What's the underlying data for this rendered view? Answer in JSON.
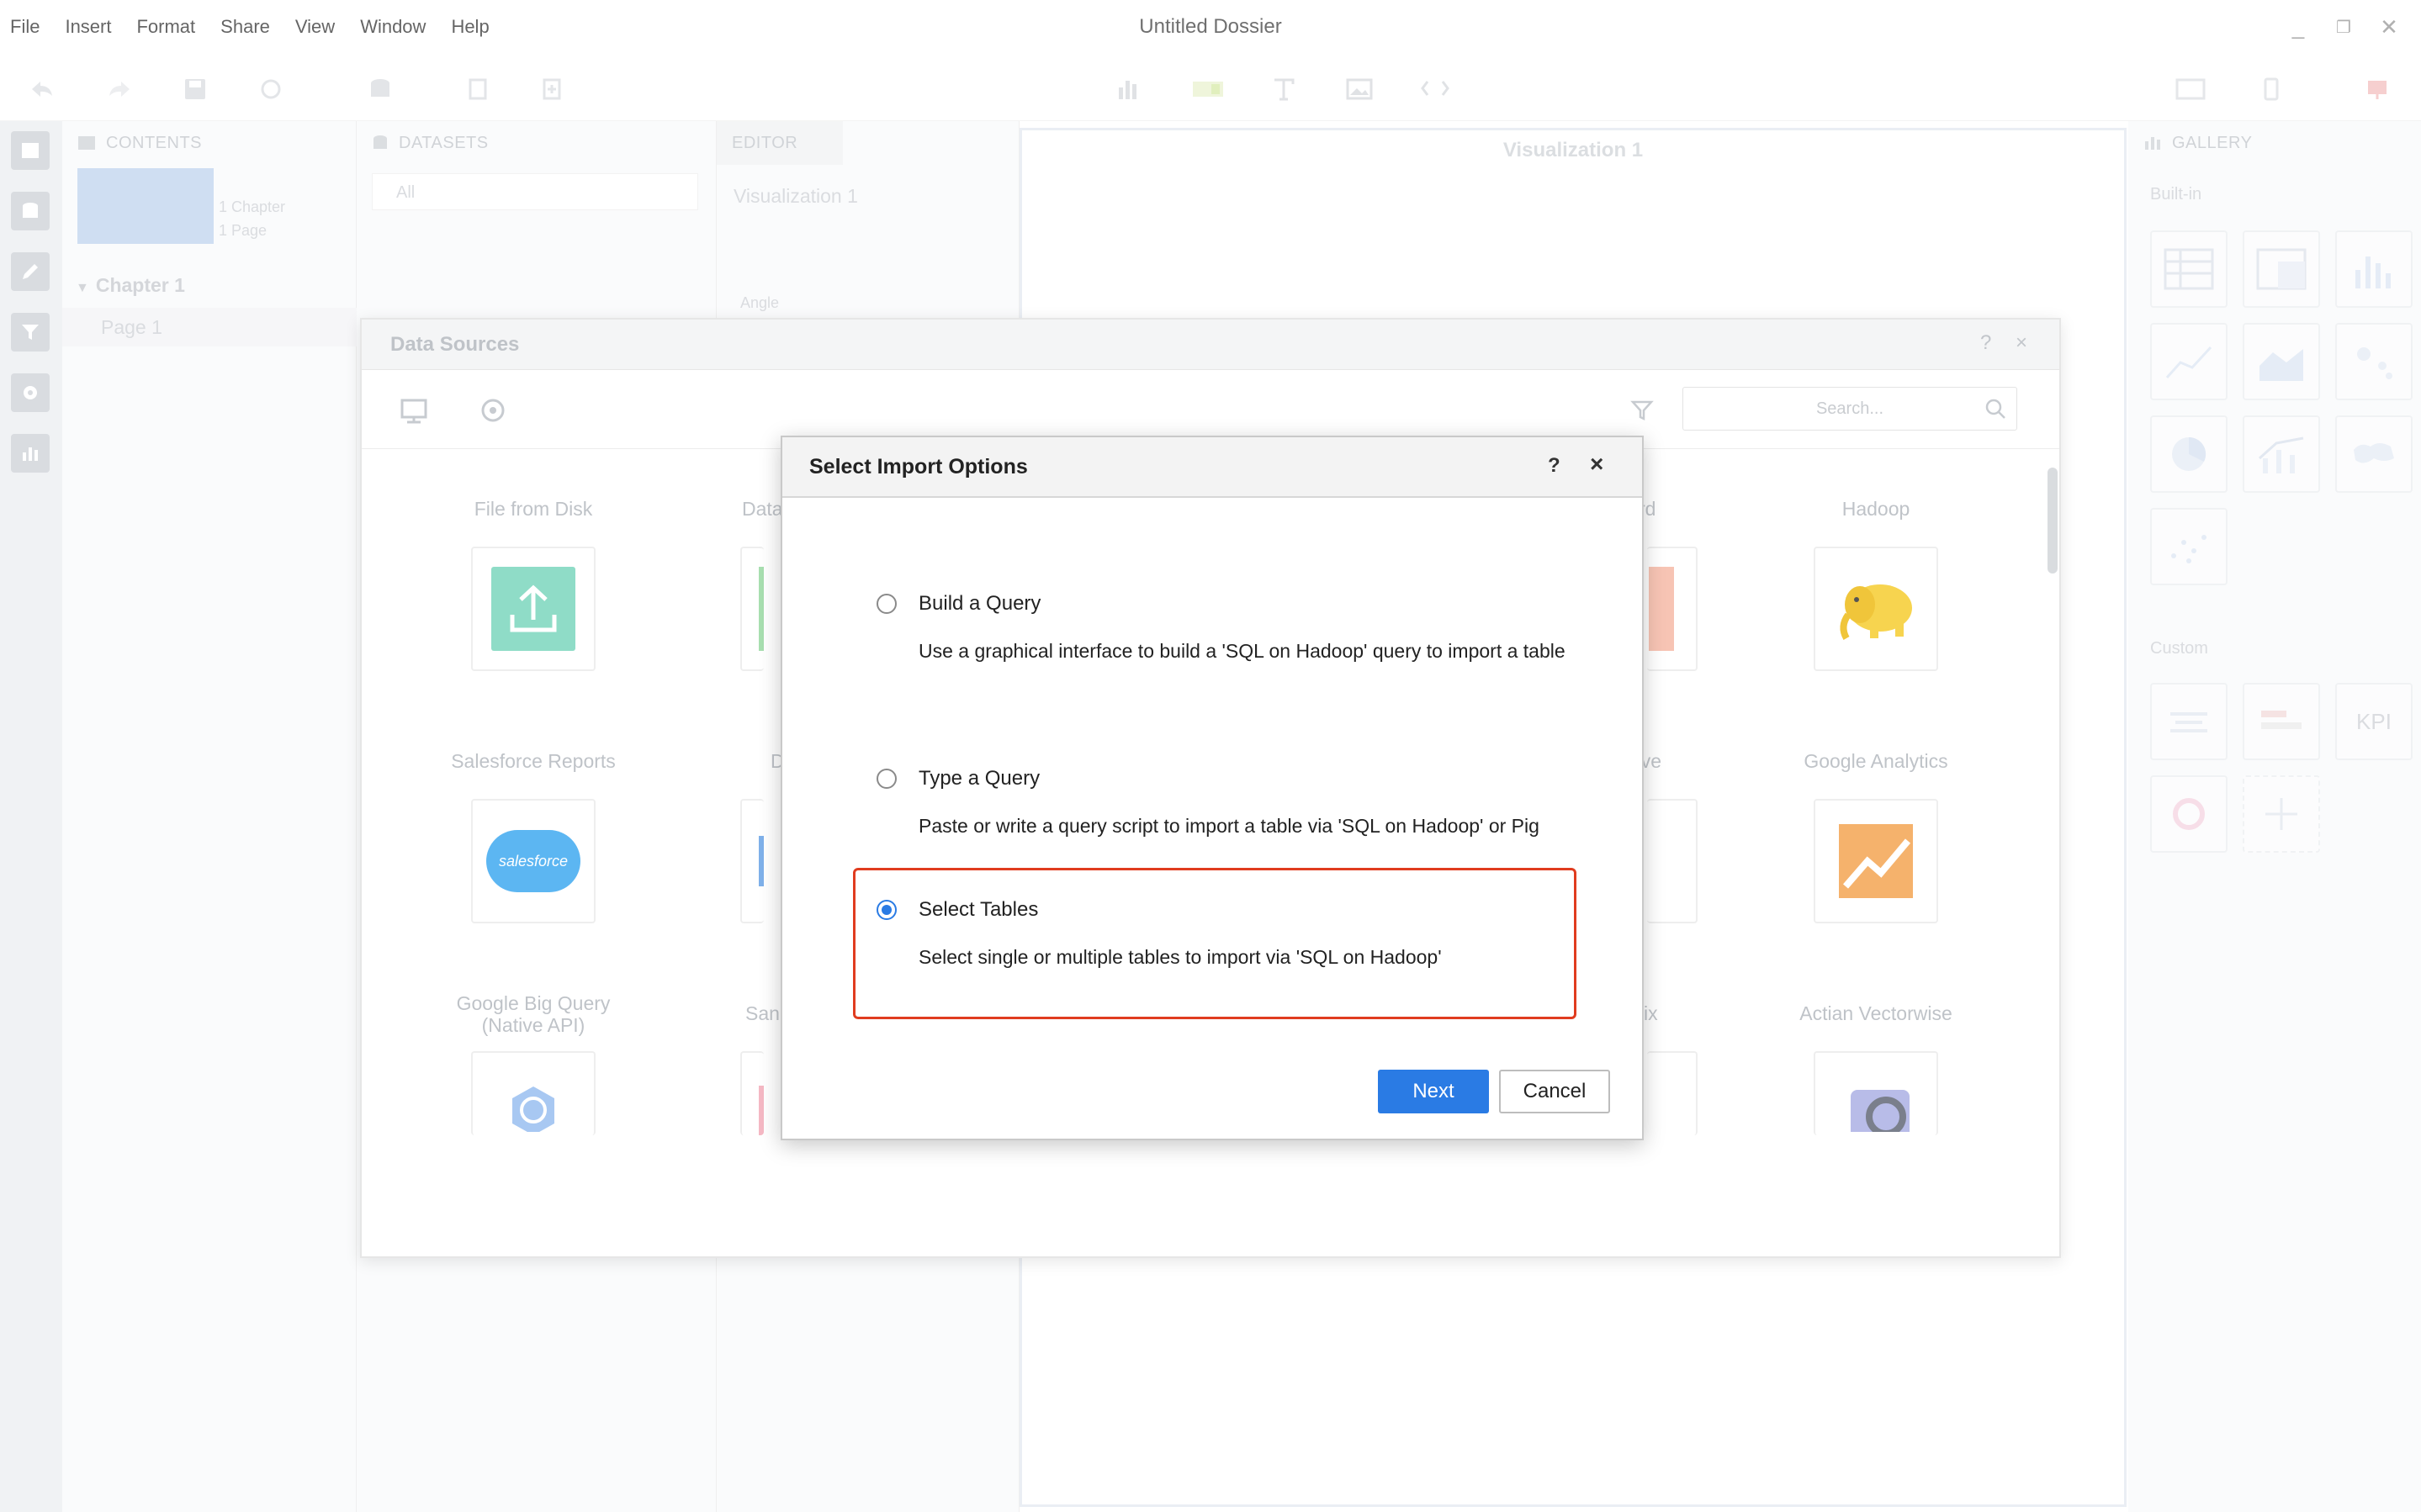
{
  "menu": [
    "File",
    "Insert",
    "Format",
    "Share",
    "View",
    "Window",
    "Help"
  ],
  "window": {
    "title": "Untitled Dossier",
    "minimize": "_",
    "restore": "❐",
    "close": "✕"
  },
  "contents_panel": {
    "header": "CONTENTS",
    "chapter_count": "1 Chapter",
    "page_count": "1 Page",
    "chapter": "Chapter 1",
    "page": "Page 1"
  },
  "datasets_panel": {
    "header": "DATASETS",
    "filter_value": "All"
  },
  "editor_panel": {
    "header": "EDITOR",
    "viz_name": "Visualization 1",
    "field_label": "Angle"
  },
  "canvas": {
    "title": "Visualization 1"
  },
  "gallery": {
    "header": "GALLERY",
    "builtin_label": "Built-in",
    "custom_label": "Custom",
    "kpi_label": "KPI"
  },
  "data_sources": {
    "title": "Data Sources",
    "help": "?",
    "close": "×",
    "search_placeholder": "Search...",
    "sources": [
      {
        "label": "File from Disk"
      },
      {
        "label": "Data"
      },
      {
        "label": "rd"
      },
      {
        "label": "Hadoop"
      },
      {
        "label": "Salesforce Reports"
      },
      {
        "label": "D"
      },
      {
        "label": "rive"
      },
      {
        "label": "Google Analytics"
      },
      {
        "label": "Google Big Query (Native API)"
      },
      {
        "label": "San"
      },
      {
        "label": "trix"
      },
      {
        "label": "Actian Vectorwise"
      }
    ],
    "salesforce_logo_text": "salesforce"
  },
  "import_dialog": {
    "title": "Select Import Options",
    "help": "?",
    "close": "×",
    "options": [
      {
        "label": "Build a Query",
        "description": "Use a graphical interface to build a 'SQL on Hadoop' query to import a table",
        "selected": false
      },
      {
        "label": "Type a Query",
        "description": "Paste or write a query script to import a table via 'SQL on Hadoop' or Pig",
        "selected": false
      },
      {
        "label": "Select Tables",
        "description": "Select single or multiple tables to import via 'SQL on Hadoop'",
        "selected": true
      }
    ],
    "next_label": "Next",
    "cancel_label": "Cancel"
  },
  "colors": {
    "accent": "#2a7be4",
    "highlight": "#e03c1f",
    "file_tile": "#8fdcc7",
    "salesforce": "#5cb6f2",
    "analytics": "#f5b26c",
    "bigquery": "#a8c8f2"
  }
}
